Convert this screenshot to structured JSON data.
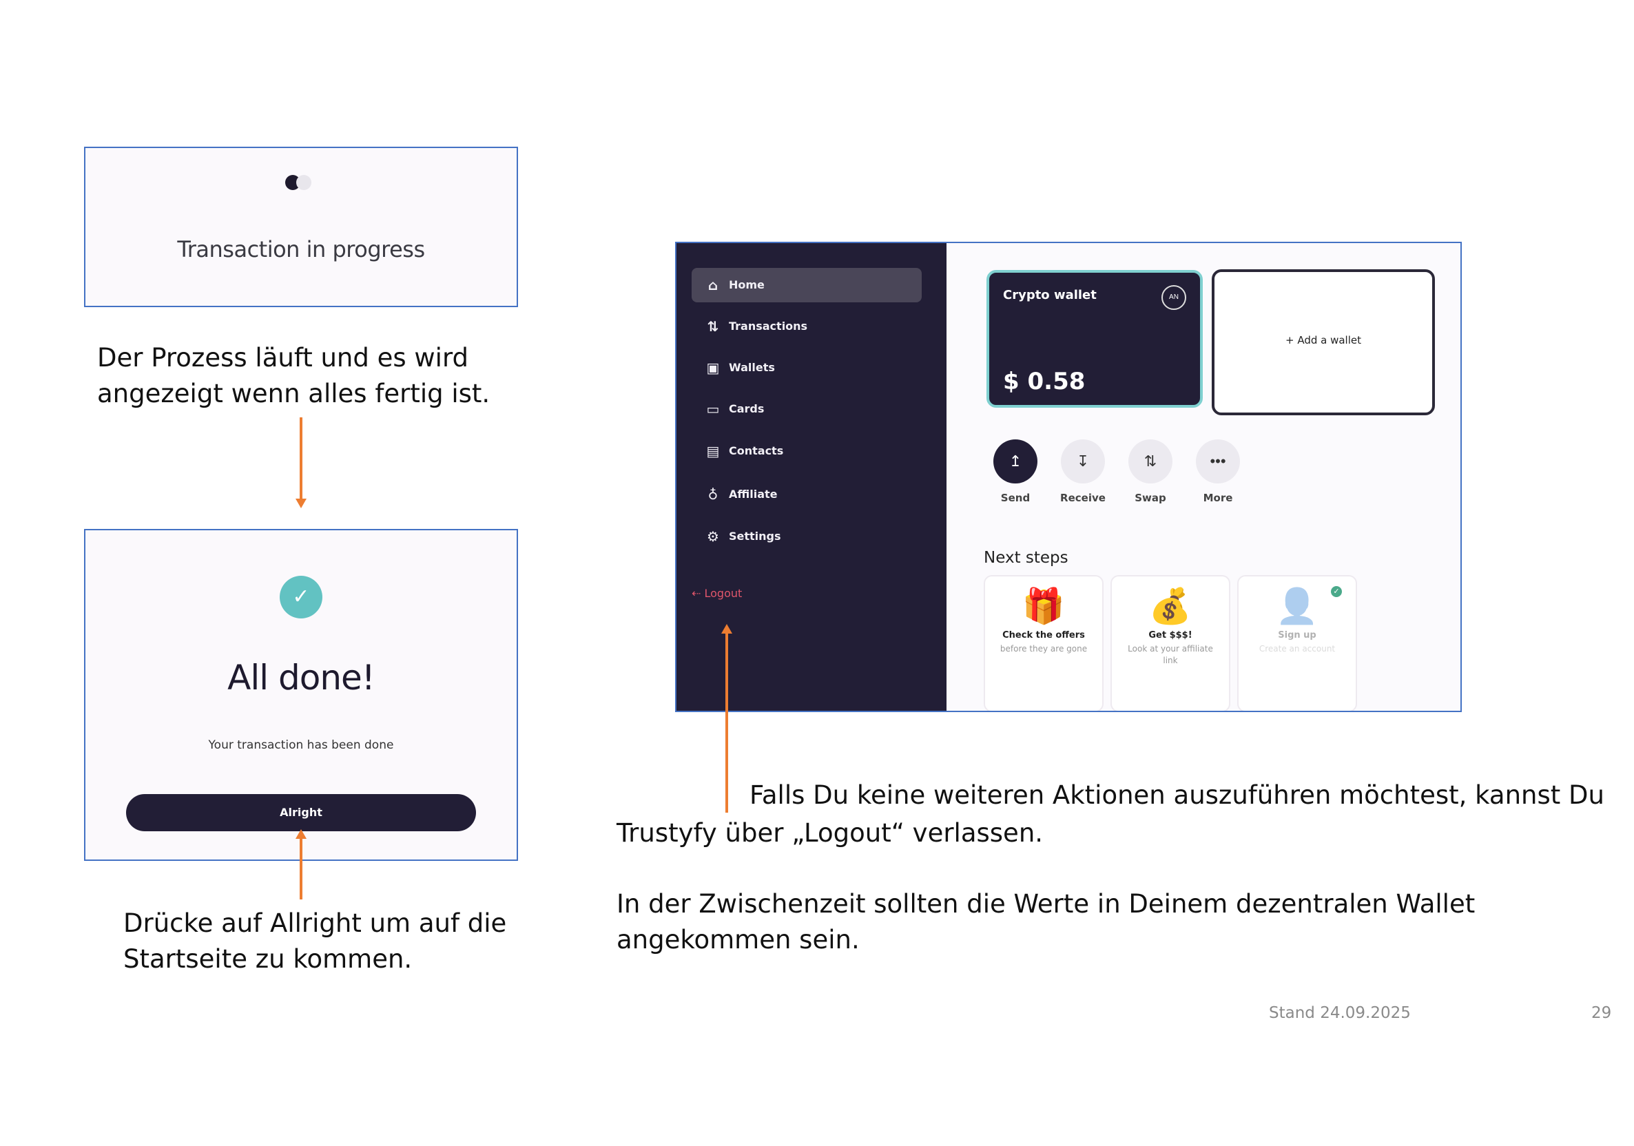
{
  "progress_panel": {
    "title": "Transaction in progress"
  },
  "done_panel": {
    "title": "All done!",
    "subtitle": "Your transaction has been done",
    "button_label": "Alright"
  },
  "captions": {
    "progress": "Der Prozess läuft und es wird angezeigt wenn alles fertig ist.",
    "alright": "Drücke auf Allright um auf die Startseite zu kommen.",
    "logout_line1": "Falls Du keine weiteren Aktionen auszuführen möchtest, kannst Du",
    "logout_line2": "Trustyfy über „Logout“ verlassen.",
    "wallet": "In der Zwischenzeit sollten die Werte in Deinem dezentralen Wallet angekommen sein."
  },
  "dashboard": {
    "sidebar": {
      "items": [
        {
          "label": "Home",
          "icon": "home-icon"
        },
        {
          "label": "Transactions",
          "icon": "transactions-icon"
        },
        {
          "label": "Wallets",
          "icon": "wallet-icon"
        },
        {
          "label": "Cards",
          "icon": "card-icon"
        },
        {
          "label": "Contacts",
          "icon": "contacts-icon"
        },
        {
          "label": "Affiliate",
          "icon": "affiliate-icon"
        },
        {
          "label": "Settings",
          "icon": "gear-icon"
        }
      ],
      "logout": "Logout",
      "active": "Home"
    },
    "wallet_card": {
      "name": "Crypto wallet",
      "badge": "AN",
      "amount": "$ 0.58"
    },
    "add_wallet": "+ Add a wallet",
    "actions": [
      {
        "label": "Send",
        "icon": "send-icon"
      },
      {
        "label": "Receive",
        "icon": "receive-icon"
      },
      {
        "label": "Swap",
        "icon": "swap-icon"
      },
      {
        "label": "More",
        "icon": "more-icon"
      }
    ],
    "next_steps": {
      "title": "Next steps",
      "items": [
        {
          "title": "Check the offers",
          "desc": "before they are gone"
        },
        {
          "title": "Get $$$!",
          "desc": "Look at your affiliate link"
        },
        {
          "title": "Sign up",
          "desc": "Create an account"
        }
      ]
    },
    "colors": {
      "sidebar": "#221e36",
      "accent": "#7fd0d0",
      "logout": "#e0566b"
    }
  },
  "footer": {
    "date": "Stand 24.09.2025",
    "page": "29"
  },
  "colors": {
    "arrow": "#ed7d31",
    "frame": "#4472c4"
  }
}
